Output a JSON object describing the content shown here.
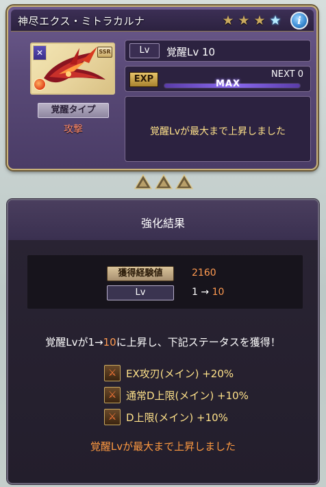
{
  "item": {
    "name": "神尽エクス・ミトラカルナ",
    "rarity_badge": "SSR",
    "stars_total": 4,
    "stars_filled_gold": 3,
    "awakening_type_label": "覚醒タイプ",
    "awakening_type_value": "攻撃",
    "lv_tag": "Lv",
    "lv_text": "覚醒Lv 10",
    "exp_tag": "EXP",
    "next_text": "NEXT 0",
    "exp_fill_fraction": 1.0,
    "max_label": "MAX",
    "message": "覚醒Lvが最大まで上昇しました"
  },
  "result": {
    "title": "強化結果",
    "exp_label": "獲得経験値",
    "exp_value": "2160",
    "lv_label": "Lv",
    "lv_from": "1",
    "lv_arrow": "→",
    "lv_to": "10",
    "gain_prefix": "覚醒Lvが",
    "gain_from": "1",
    "gain_arrow": "→",
    "gain_to": "10",
    "gain_suffix": "に上昇し、下記ステータスを獲得！",
    "bonuses": [
      {
        "label": "EX攻刃(メイン) +20%"
      },
      {
        "label": "通常D上限(メイン) +10%"
      },
      {
        "label": "D上限(メイン) +10%"
      }
    ],
    "footer": "覚醒Lvが最大まで上昇しました"
  },
  "colors": {
    "accent_gold": "#c9b27a",
    "value_orange": "#ff9a50",
    "message_yellow": "#ffe28a",
    "panel_purple": "#5a4a78"
  },
  "icons": {
    "info": "info-icon",
    "star": "star-icon",
    "bonus": "sword-buff-icon",
    "arrow": "triangle-arrow-icon"
  }
}
